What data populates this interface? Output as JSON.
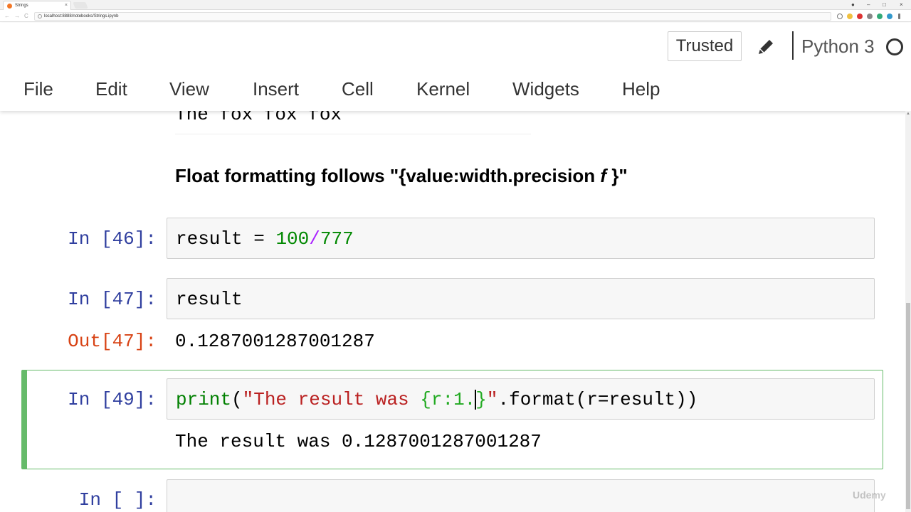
{
  "browser": {
    "tab_title": "Strings",
    "tab_close": "×",
    "url": "localhost:8888/notebooks/Strings.ipynb",
    "back": "←",
    "forward": "→",
    "reload": "C",
    "minimize": "–",
    "maximize": "□",
    "close": "×"
  },
  "header": {
    "trusted_label": "Trusted",
    "kernel_name": "Python 3"
  },
  "menu": [
    "File",
    "Edit",
    "View",
    "Insert",
    "Cell",
    "Kernel",
    "Widgets",
    "Help"
  ],
  "notebook": {
    "previous_output": "The fox fox fox",
    "markdown_heading": {
      "before": "Float formatting follows \"{value:width.precision ",
      "italic": "f",
      "after": " }\""
    },
    "cells": [
      {
        "prompt": "In [46]:",
        "code_tokens": [
          "result = ",
          "100",
          "/",
          "777"
        ]
      },
      {
        "prompt": "In [47]:",
        "code_tokens": [
          "result"
        ],
        "out_prompt": "Out[47]:",
        "output": "0.1287001287001287"
      },
      {
        "prompt": "In [49]:",
        "code_tokens": [
          "print",
          "(",
          "\"The result was ",
          "{r:1.",
          "}",
          "\"",
          ".format(r=result))"
        ],
        "output": "The result was 0.1287001287001287",
        "selected": true
      },
      {
        "prompt": "In [ ]:"
      }
    ]
  },
  "watermark": "Udemy",
  "colors": {
    "prompt_in": "#303f9f",
    "prompt_out": "#d84315",
    "selected_border": "#66bb6a",
    "string": "#ba2121",
    "number": "#008800",
    "operator": "#aa22ff"
  }
}
